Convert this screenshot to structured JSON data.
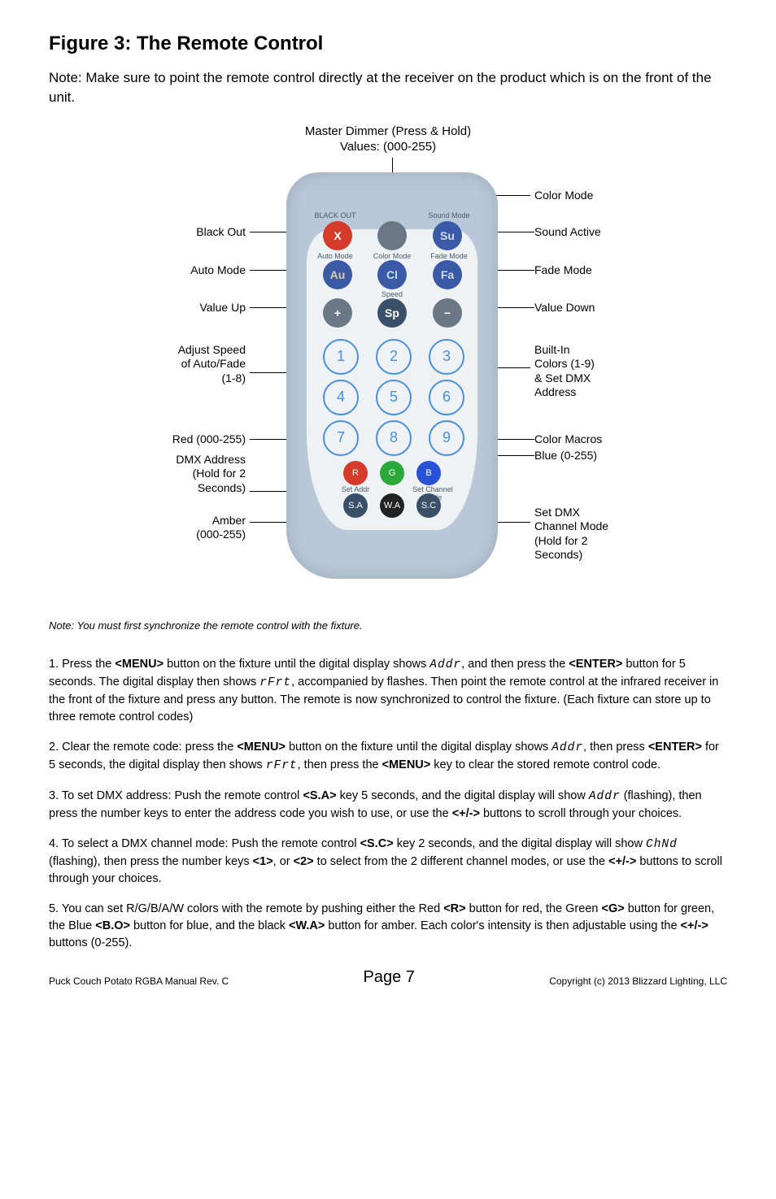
{
  "title": "Figure 3: The Remote Control",
  "intro": "Note: Make sure to point the remote control directly at the receiver on the product which is on the front of the unit.",
  "dimmer_header_l1": "Master Dimmer (Press & Hold)",
  "dimmer_header_l2": "Values: (000-255)",
  "left": {
    "blackout": "Black Out",
    "auto": "Auto Mode",
    "valueup": "Value Up",
    "speed_l1": "Adjust Speed",
    "speed_l2": "of Auto/Fade",
    "speed_l3": "(1-8)",
    "red": "Red (000-255)",
    "dmx_l1": "DMX Address",
    "dmx_l2": "(Hold for 2",
    "dmx_l3": "Seconds)",
    "amber_l1": "Amber",
    "amber_l2": "(000-255)"
  },
  "right": {
    "colormode": "Color Mode",
    "sound": "Sound Active",
    "fade": "Fade Mode",
    "valuedown": "Value Down",
    "builtin_l1": "Built-In",
    "builtin_l2": "Colors (1-9)",
    "builtin_l3": "& Set DMX",
    "builtin_l4": "Address",
    "macros": "Color Macros",
    "blue": "Blue (0-255)",
    "setdmx_l1": "Set DMX",
    "setdmx_l2": "Channel Mode",
    "setdmx_l3": "(Hold for 2",
    "setdmx_l4": "Seconds)"
  },
  "buttons": {
    "x": "X",
    "su": "Su",
    "au": "Au",
    "cl": "Cl",
    "fa": "Fa",
    "plus": "+",
    "sp": "Sp",
    "minus": "−",
    "n1": "1",
    "n2": "2",
    "n3": "3",
    "n4": "4",
    "n5": "5",
    "n6": "6",
    "n7": "7",
    "n8": "8",
    "n9": "9",
    "r": "R",
    "g": "G",
    "b": "B",
    "sa": "S.A",
    "wa": "W.A",
    "sc": "S.C"
  },
  "rlabels": {
    "blackout": "BLACK OUT",
    "soundmode": "Sound Mode",
    "automode": "Auto Mode",
    "colormode": "Color Mode",
    "fademode": "Fade Mode",
    "speed": "Speed",
    "setaddr": "Set Addr",
    "setchannel": "Set Channel Mode"
  },
  "sync_note": "Note: You must first synchronize the remote control with the fixture.",
  "steps": {
    "s1a": "1. Press the ",
    "s1menu": "<MENU>",
    "s1b": " button on the fixture until the digital display shows ",
    "s1addr": "Addr",
    "s1c": ", and then press the ",
    "s1enter": "<ENTER>",
    "s1d": " button for 5 seconds. The digital display then shows ",
    "s1rfrt": "rFrt",
    "s1e": ", accompanied by flashes. Then point the remote control at the infrared receiver in the front of the fixture and press any button. The remote is now synchronized to control the fixture. (Each fixture can store up to three remote control codes)",
    "s2a": "2. Clear the remote code: press the ",
    "s2b": " button on the fixture until the digital display shows ",
    "s2c": ", then press ",
    "s2d": " for 5 seconds, the digital display then shows ",
    "s2e": ", then press the ",
    "s2f": " key to clear the stored remote control code.",
    "s3a": "3. To set DMX address: Push the remote control ",
    "s3sa": "<S.A>",
    "s3b": " key 5 seconds, and the digital display will show ",
    "s3c": " (flashing), then press the number keys to enter the address code you wish to use, or use the ",
    "s3pm": "<+/->",
    "s3d": " buttons to scroll through your choices.",
    "s4a": "4. To select a DMX channel mode: Push the remote control ",
    "s4sc": "<S.C>",
    "s4b": " key 2 seconds, and the digital display will show ",
    "s4chnd": "ChNd",
    "s4c": " (flashing), then press the number keys ",
    "s4one": "<1>",
    "s4d": ", or ",
    "s4two": "<2>",
    "s4e": " to select from the 2 different channel modes, or use the ",
    "s4f": " buttons to scroll through your choices.",
    "s5a": "5. You can set R/G/B/A/W colors with the remote by pushing either the Red ",
    "s5r": "<R>",
    "s5b": " button for red, the Green ",
    "s5g": "<G>",
    "s5c": " button for green, the Blue ",
    "s5bo": "<B.O>",
    "s5d": " button for blue, and the black ",
    "s5wa": "<W.A>",
    "s5e": " button for amber. Each color's intensity is then adjustable using the ",
    "s5f": " buttons (0-255)."
  },
  "footer": {
    "left": "Puck Couch Potato RGBA Manual Rev. C",
    "center": "Page 7",
    "right": "Copyright (c) 2013 Blizzard Lighting, LLC"
  }
}
